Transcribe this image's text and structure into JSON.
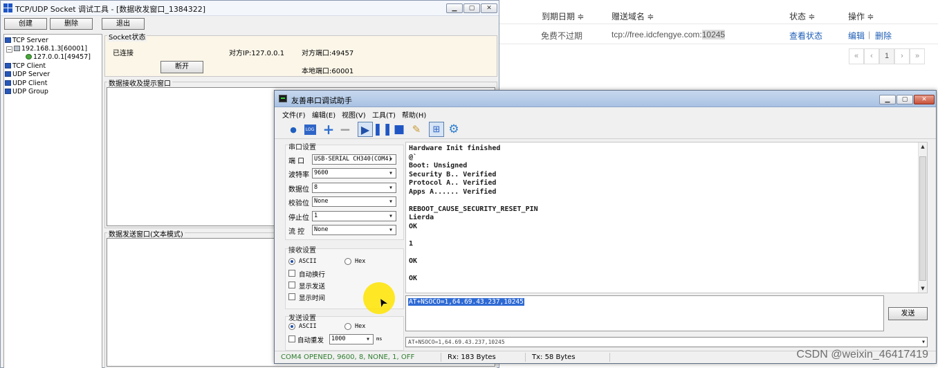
{
  "webpage": {
    "headers": {
      "expire_date": "到期日期 ≑",
      "gift_domain": "赠送域名 ≑",
      "status": "状态 ≑",
      "actions": "操作 ≑"
    },
    "row": {
      "expire_value": "免费不过期",
      "domain_prefix": "tcp://free.idcfengye.com:",
      "domain_port": "10245",
      "view_status": "查看状态",
      "edit": "编辑",
      "sep": "|",
      "delete": "删除"
    },
    "pagination": [
      "«",
      "‹",
      "1",
      "›",
      "»"
    ]
  },
  "socket_tool": {
    "title": "TCP/UDP Socket 调试工具 - [数据收发窗口_1384322]",
    "window_buttons": [
      "▁",
      "▢",
      "✕"
    ],
    "toolbar": {
      "create": "创建",
      "delete": "删除",
      "exit": "退出"
    },
    "tree": {
      "tcp_server": "TCP Server",
      "server_addr": "192.168.1.3[60001]",
      "client_addr": "127.0.0.1[49457]",
      "tcp_client": "TCP Client",
      "udp_server": "UDP Server",
      "udp_client": "UDP Client",
      "udp_group": "UDP Group"
    },
    "socket_status": {
      "legend": "Socket状态",
      "connected": "已连接",
      "peer_ip": "对方IP:127.0.0.1",
      "peer_port": "对方端口:49457",
      "local_port": "本地端口:60001",
      "disconnect": "断开"
    },
    "recv_panel_title": "数据接收及提示窗口",
    "send_panel_title": "数据发送窗口(文本模式)",
    "bottom_fragment": "",
    "bottom_button_fragment": ""
  },
  "serial_tool": {
    "title": "友善串口调试助手",
    "menu": [
      "文件(F)",
      "编辑(E)",
      "视图(V)",
      "工具(T)",
      "帮助(H)"
    ],
    "port_settings": {
      "title": "串口设置",
      "port_label": "端  口",
      "port_value": "USB-SERIAL CH340(COM4)",
      "baud_label": "波特率",
      "baud_value": "9600",
      "databits_label": "数据位",
      "databits_value": "8",
      "parity_label": "校验位",
      "parity_value": "None",
      "stopbits_label": "停止位",
      "stopbits_value": "1",
      "flow_label": "流  控",
      "flow_value": "None"
    },
    "recv_settings": {
      "title": "接收设置",
      "ascii": "ASCII",
      "hex": "Hex",
      "auto_newline": "自动换行",
      "show_send": "显示发送",
      "show_time": "显示时间"
    },
    "send_settings": {
      "title": "发送设置",
      "ascii": "ASCII",
      "hex": "Hex",
      "auto_resend": "自动重发",
      "interval": "1000",
      "unit": "ms"
    },
    "recv_lines": [
      "Hardware Init finished",
      "@`",
      "Boot: Unsigned",
      "Security B.. Verified",
      "Protocol A.. Verified",
      "Apps A...... Verified",
      "",
      "REBOOT_CAUSE_SECURITY_RESET_PIN",
      "Lierda",
      "OK",
      "",
      "1",
      "",
      "OK",
      "",
      "OK"
    ],
    "send_text": "AT+NSOCO=1,64.69.43.237,10245",
    "send_button": "发送",
    "history_value": "AT+NSOCO=1,64.69.43.237,10245",
    "status": {
      "port_state": "COM4 OPENED, 9600, 8, NONE, 1, OFF",
      "rx": "Rx: 183 Bytes",
      "tx": "Tx: 58 Bytes"
    }
  },
  "watermark": "CSDN @weixin_46417419",
  "colors": {
    "link_blue": "#1e5eb6",
    "status_green": "#2e7d2e",
    "selection_blue": "#2f6ad4",
    "highlight_yellow": "#ffe400"
  }
}
